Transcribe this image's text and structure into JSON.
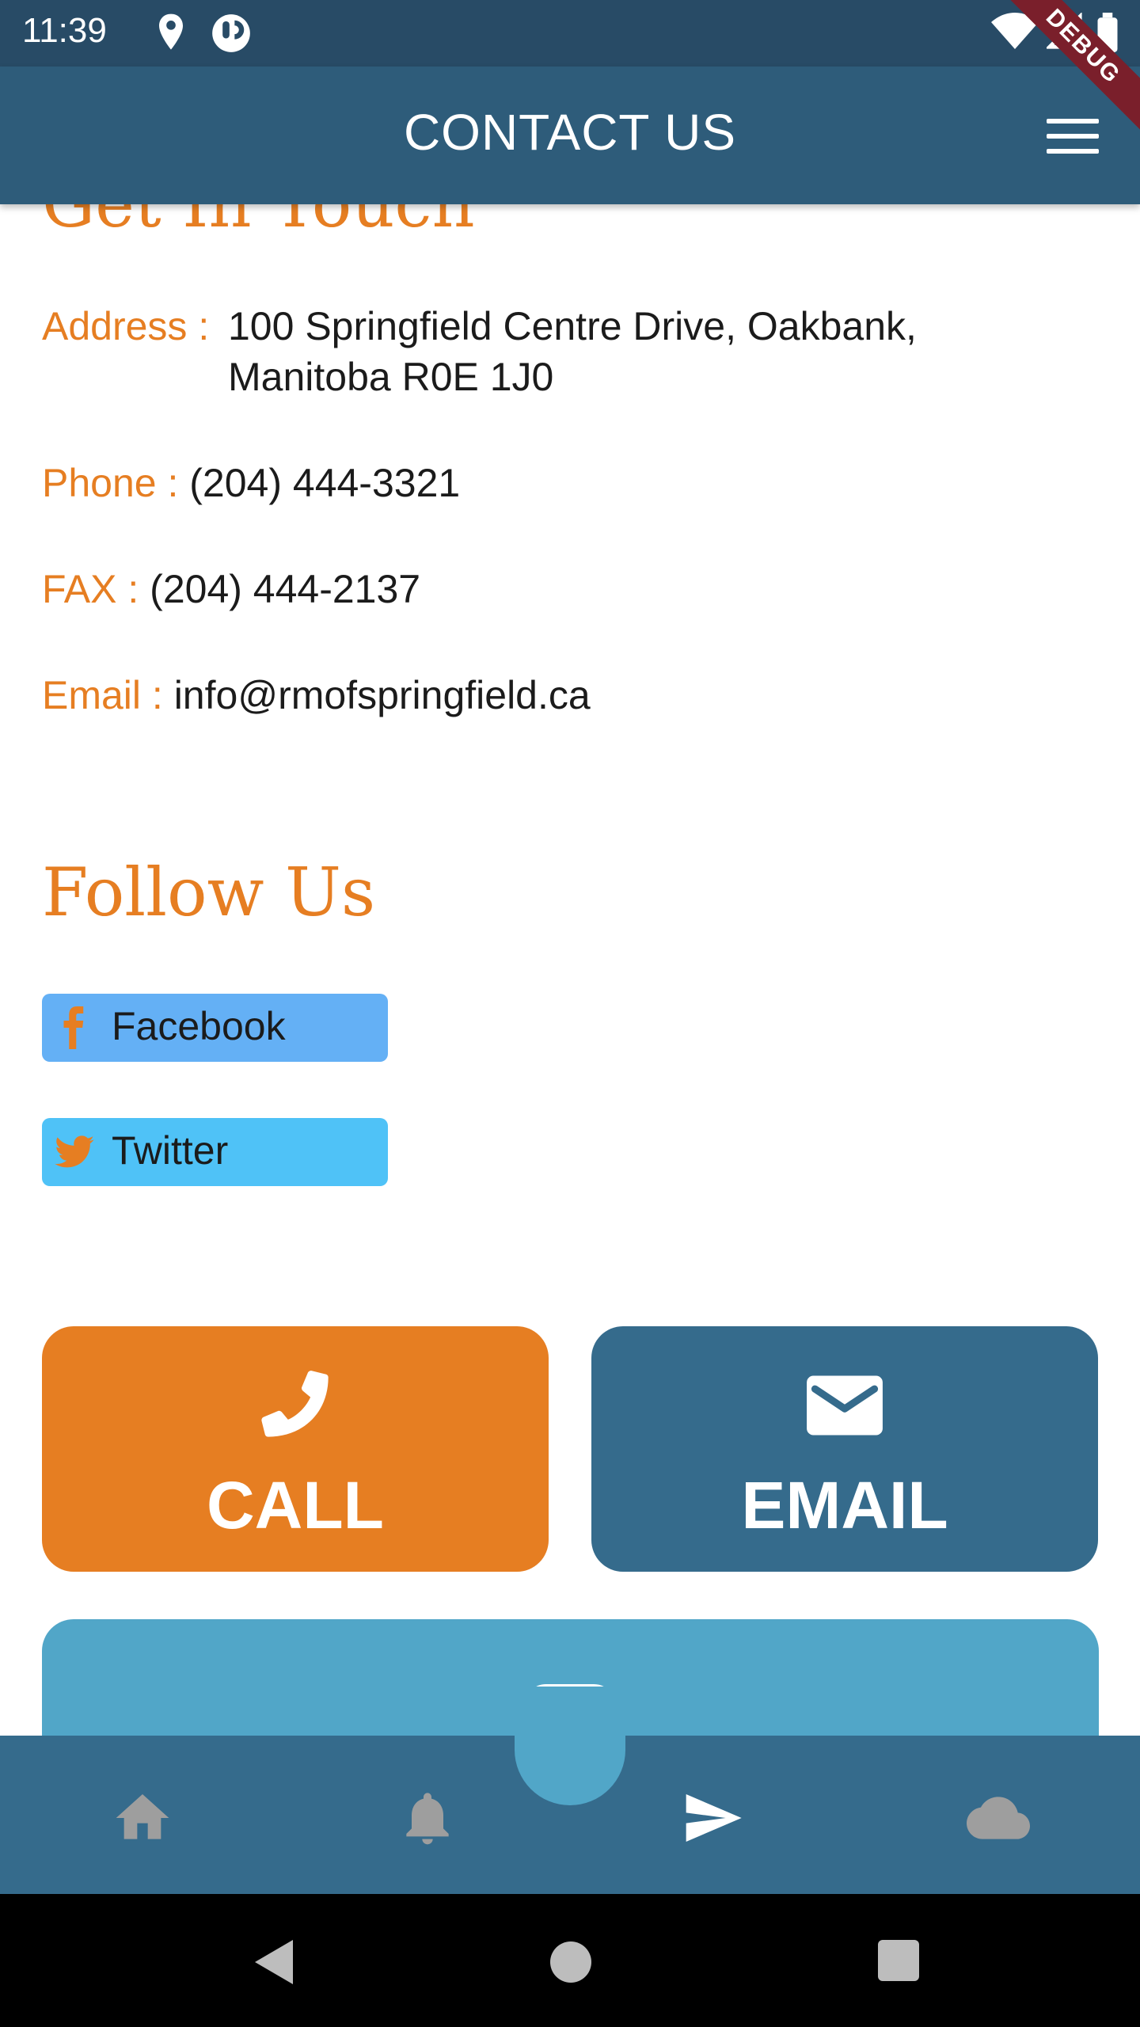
{
  "status_bar": {
    "time": "11:39",
    "icons": [
      "location-icon",
      "app-notification-icon",
      "wifi-icon",
      "signal-icon",
      "battery-icon"
    ]
  },
  "app_bar": {
    "title": "CONTACT US",
    "menu_icon": "hamburger-menu-icon",
    "debug_label": "DEBUG"
  },
  "contact": {
    "heading": "Get In Touch",
    "address_label": "Address : ",
    "address_line1": "100 Springfield Centre Drive, Oakbank,",
    "address_line2": "Manitoba R0E 1J0",
    "phone_label": "Phone : ",
    "phone_value": "(204) 444-3321",
    "fax_label": "FAX : ",
    "fax_value": "(204) 444-2137",
    "email_label": "Email : ",
    "email_value": "info@rmofspringfield.ca"
  },
  "follow": {
    "heading": "Follow Us",
    "facebook_label": "Facebook",
    "twitter_label": "Twitter"
  },
  "actions": {
    "call_label": "CALL",
    "email_label": "EMAIL",
    "link_icon": "link-icon"
  },
  "bottom_nav": {
    "items": [
      "home-icon",
      "bell-icon",
      "send-icon",
      "cloud-icon"
    ],
    "active": "send-icon"
  },
  "colors": {
    "primary": "#2e5c7a",
    "accent": "#e67e22",
    "email_button": "#356b8c",
    "link_button": "#51a6c8",
    "facebook_button": "#64b0f5",
    "twitter_button": "#4fc2f7"
  }
}
